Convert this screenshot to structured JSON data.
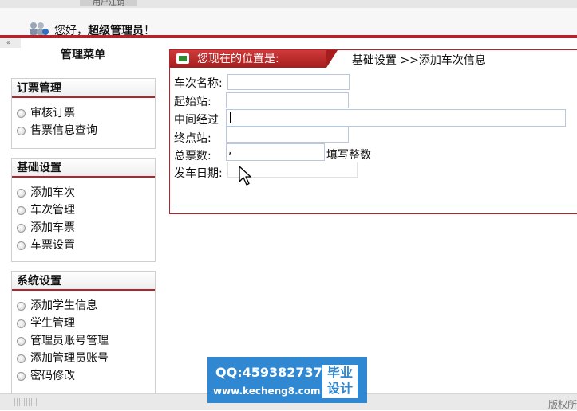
{
  "top": {
    "tab_label": "用户注销"
  },
  "header": {
    "greeting": "您好，",
    "user_name": "超级管理员",
    "suffix": "！"
  },
  "sidebar": {
    "title": "管理菜单",
    "groups": [
      {
        "title": "订票管理",
        "items": [
          "审核订票",
          "售票信息查询"
        ]
      },
      {
        "title": "基础设置",
        "items": [
          "添加车次",
          "车次管理",
          "添加车票",
          "车票设置"
        ]
      },
      {
        "title": "系统设置",
        "items": [
          "添加学生信息",
          "学生管理",
          "管理员账号管理",
          "添加管理员账号",
          "密码修改"
        ]
      }
    ]
  },
  "main": {
    "location_label": "您现在的位置是:",
    "location_path": "基础设置 >>添加车次信息",
    "form": {
      "train_name_label": "车次名称:",
      "origin_label": "起始站:",
      "via_label": "中间经过",
      "destination_label": "终点站:",
      "total_tickets_label": "总票数:",
      "total_tickets_value": ",",
      "total_tickets_hint": "填写整数",
      "departure_date_label": "发车日期:"
    }
  },
  "footer": {
    "copyright": "版权所"
  },
  "watermark": {
    "qq": "QQ:459382737",
    "url": "www.kecheng8.com",
    "badge_line1": "毕业",
    "badge_line2": "设计"
  }
}
